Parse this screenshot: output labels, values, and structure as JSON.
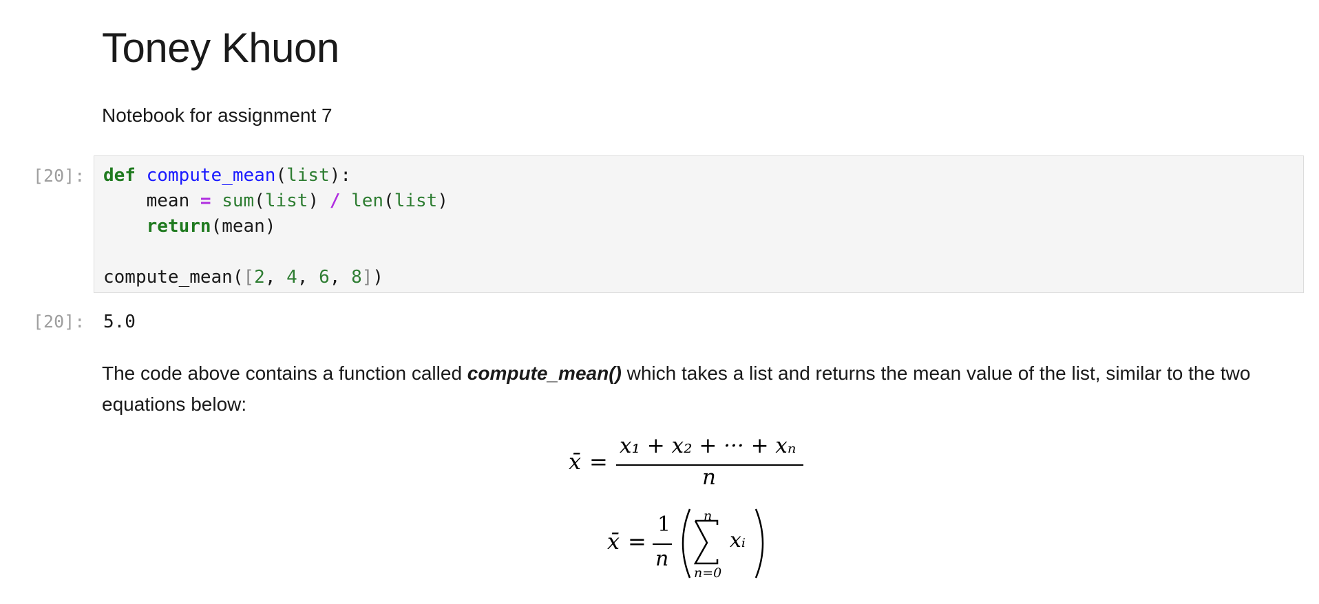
{
  "notebook": {
    "title": "Toney Khuon",
    "subtitle": "Notebook for assignment 7"
  },
  "code_cell": {
    "in_prompt": "[20]:",
    "code_lines": [
      "def compute_mean(list):",
      "    mean = sum(list) / len(list)",
      "    return(mean)",
      "",
      "compute_mean([2, 4, 6, 8])"
    ]
  },
  "output_cell": {
    "out_prompt": "[20]:",
    "value": "5.0"
  },
  "markdown": {
    "before": "The code above contains a function called ",
    "emphasis": "compute_mean()",
    "after": " which takes a list and returns the mean value of the list, similar to the two equations below:"
  },
  "equations": {
    "eq1": {
      "lhs": "x̄",
      "eq": "=",
      "numerator": "x₁ + x₂ + ··· + xₙ",
      "denominator": "n"
    },
    "eq2": {
      "lhs": "x̄",
      "eq": "=",
      "frac_num": "1",
      "frac_den": "n",
      "sum_upper": "n",
      "sum_lower": "n=0",
      "summand": "xᵢ"
    }
  }
}
